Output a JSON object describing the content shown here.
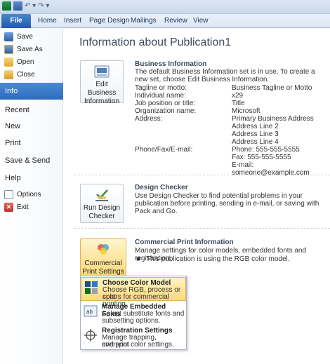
{
  "qat": {
    "undo_glyph": "↶ ▾",
    "redo_glyph": "↷ ▾"
  },
  "tabs": [
    "File",
    "Home",
    "Insert",
    "Page Design",
    "Mailings",
    "Review",
    "View"
  ],
  "nav": {
    "save": "Save",
    "save_as": "Save As",
    "open": "Open",
    "close": "Close",
    "info": "Info",
    "recent": "Recent",
    "new": "New",
    "print": "Print",
    "save_send": "Save & Send",
    "help": "Help",
    "options": "Options",
    "exit": "Exit"
  },
  "page_title": "Information about Publication1",
  "business_info": {
    "button_label": [
      "Edit Business",
      "Information"
    ],
    "title": "Business Information",
    "description": "The default Business Information set is in use. To create a new set, choose Edit Business Information.",
    "fields": [
      {
        "label": "Tagline or motto:",
        "value": [
          "Business Tagline or Motto"
        ]
      },
      {
        "label": "Individual name:",
        "value": [
          "x29"
        ]
      },
      {
        "label": "Job position or title:",
        "value": [
          "Title"
        ]
      },
      {
        "label": "Organization name:",
        "value": [
          "Microsoft"
        ]
      },
      {
        "label": "Address:",
        "value": [
          "Primary Business Address",
          "Address Line 2",
          "Address Line 3",
          "Address Line 4"
        ]
      },
      {
        "label": "Phone/Fax/E-mail:",
        "value": [
          "Phone: 555-555-5555",
          "Fax: 555-555-5555",
          "E-mail: someone@example.com"
        ]
      }
    ]
  },
  "design_checker": {
    "button_label": [
      "Run Design",
      "Checker"
    ],
    "title": "Design Checker",
    "description": "Use Design Checker to find potential problems in your publication before printing, sending in e-mail, or saving with Pack and Go."
  },
  "commercial_print": {
    "button_label": [
      "Commercial",
      "Print Settings ▾"
    ],
    "title": "Commercial Print Information",
    "description": "Manage settings for color models, embedded fonts and registration.",
    "note": "This publication is using the RGB color model."
  },
  "menu": [
    {
      "title": "Choose Color Model",
      "desc": [
        "Choose RGB, process or spot",
        "colors for commercial printing."
      ],
      "icon": "color-model-icon"
    },
    {
      "title": "Manage Embedded Fonts",
      "desc": [
        "Select substitute fonts and",
        "subsetting options."
      ],
      "icon": "embedded-fonts-icon"
    },
    {
      "title": "Registration Settings",
      "desc": [
        "Manage trapping, overprint",
        "and spot color settings."
      ],
      "icon": "registration-icon"
    }
  ],
  "colors": {
    "accent": "#2b6cbd",
    "highlight": "#fcd97a"
  }
}
